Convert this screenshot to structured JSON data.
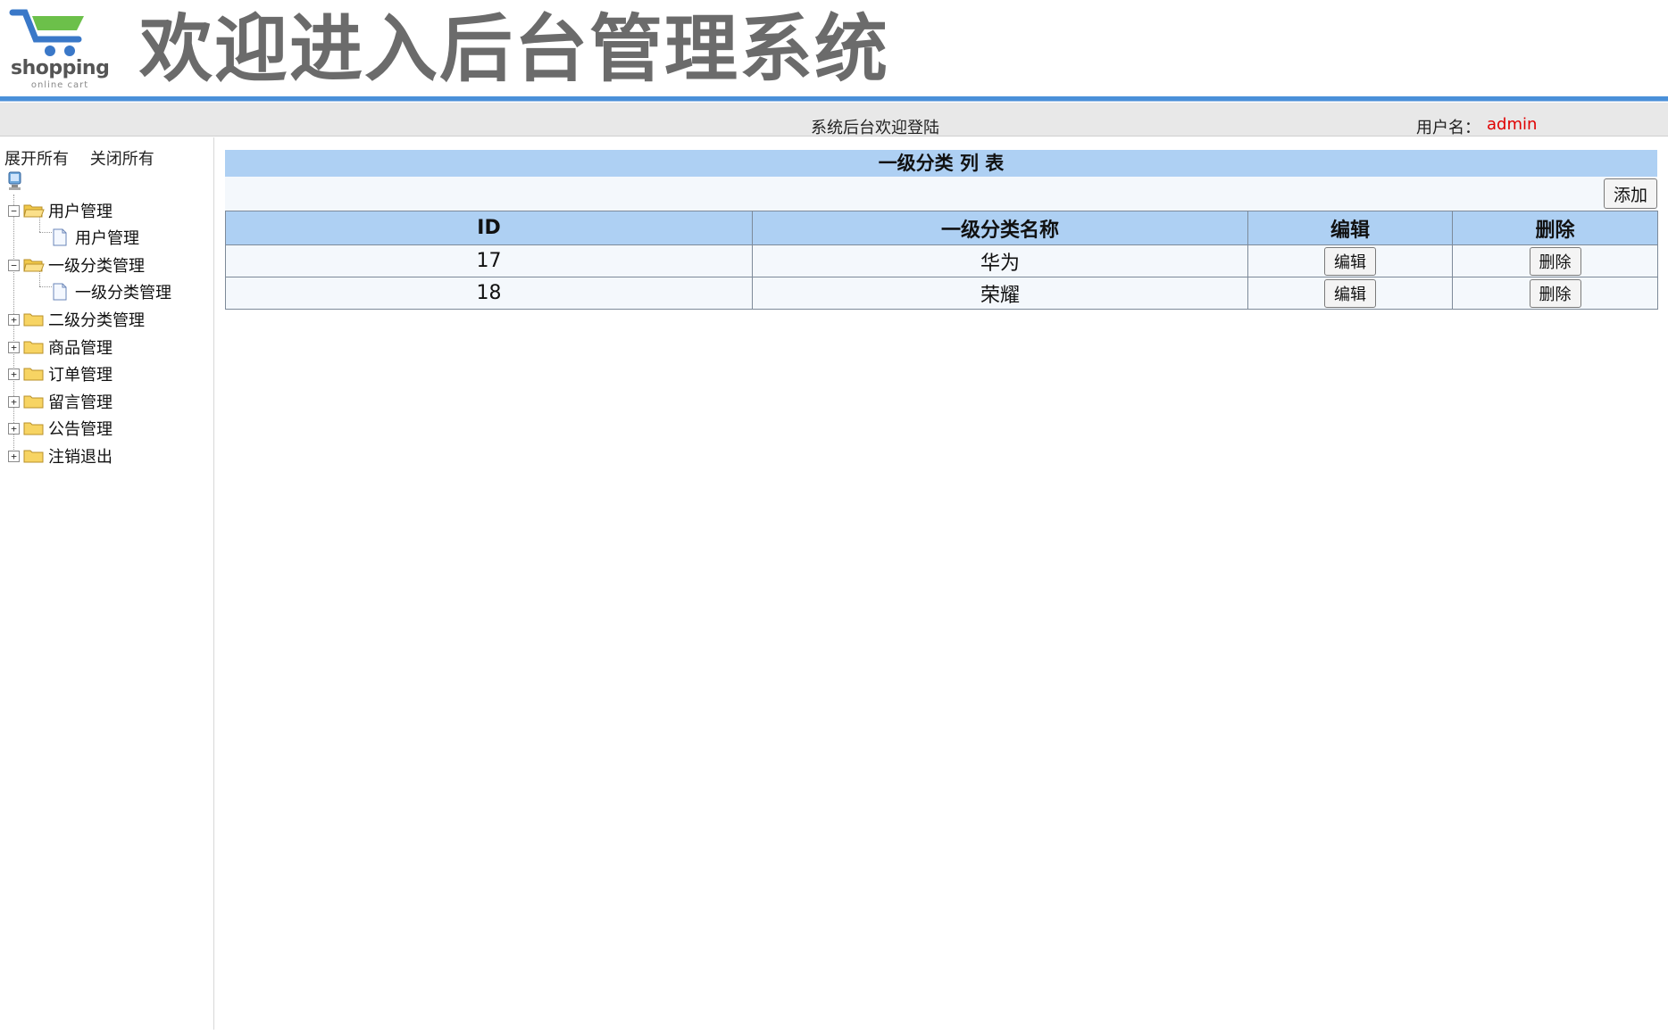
{
  "header": {
    "logo_text": "shopping",
    "logo_subtext": "online cart",
    "title": "欢迎进入后台管理系统"
  },
  "statusbar": {
    "welcome": "系统后台欢迎登陆",
    "user_label": "用户名：",
    "user_value": "admin",
    "user_color": "#e00000"
  },
  "sidebar": {
    "expand_all": "展开所有",
    "collapse_all": "关闭所有",
    "tree": [
      {
        "label": "用户管理",
        "toggle": "−",
        "children": [
          {
            "label": "用户管理"
          }
        ]
      },
      {
        "label": "一级分类管理",
        "toggle": "−",
        "children": [
          {
            "label": "一级分类管理"
          }
        ]
      },
      {
        "label": "二级分类管理",
        "toggle": "+"
      },
      {
        "label": "商品管理",
        "toggle": "+"
      },
      {
        "label": "订单管理",
        "toggle": "+"
      },
      {
        "label": "留言管理",
        "toggle": "+"
      },
      {
        "label": "公告管理",
        "toggle": "+"
      },
      {
        "label": "注销退出",
        "toggle": "+"
      }
    ]
  },
  "main": {
    "table_title": "一级分类 列 表",
    "add_button": "添加",
    "columns": [
      "ID",
      "一级分类名称",
      "编辑",
      "删除"
    ],
    "rows": [
      {
        "id": "17",
        "name": "华为",
        "edit": "编辑",
        "delete": "删除"
      },
      {
        "id": "18",
        "name": "荣耀",
        "edit": "编辑",
        "delete": "删除"
      }
    ]
  },
  "colors": {
    "header_blue_line": "#4a90d9",
    "table_header_bg": "#aed0f3",
    "row_bg": "#f4f8fc"
  }
}
